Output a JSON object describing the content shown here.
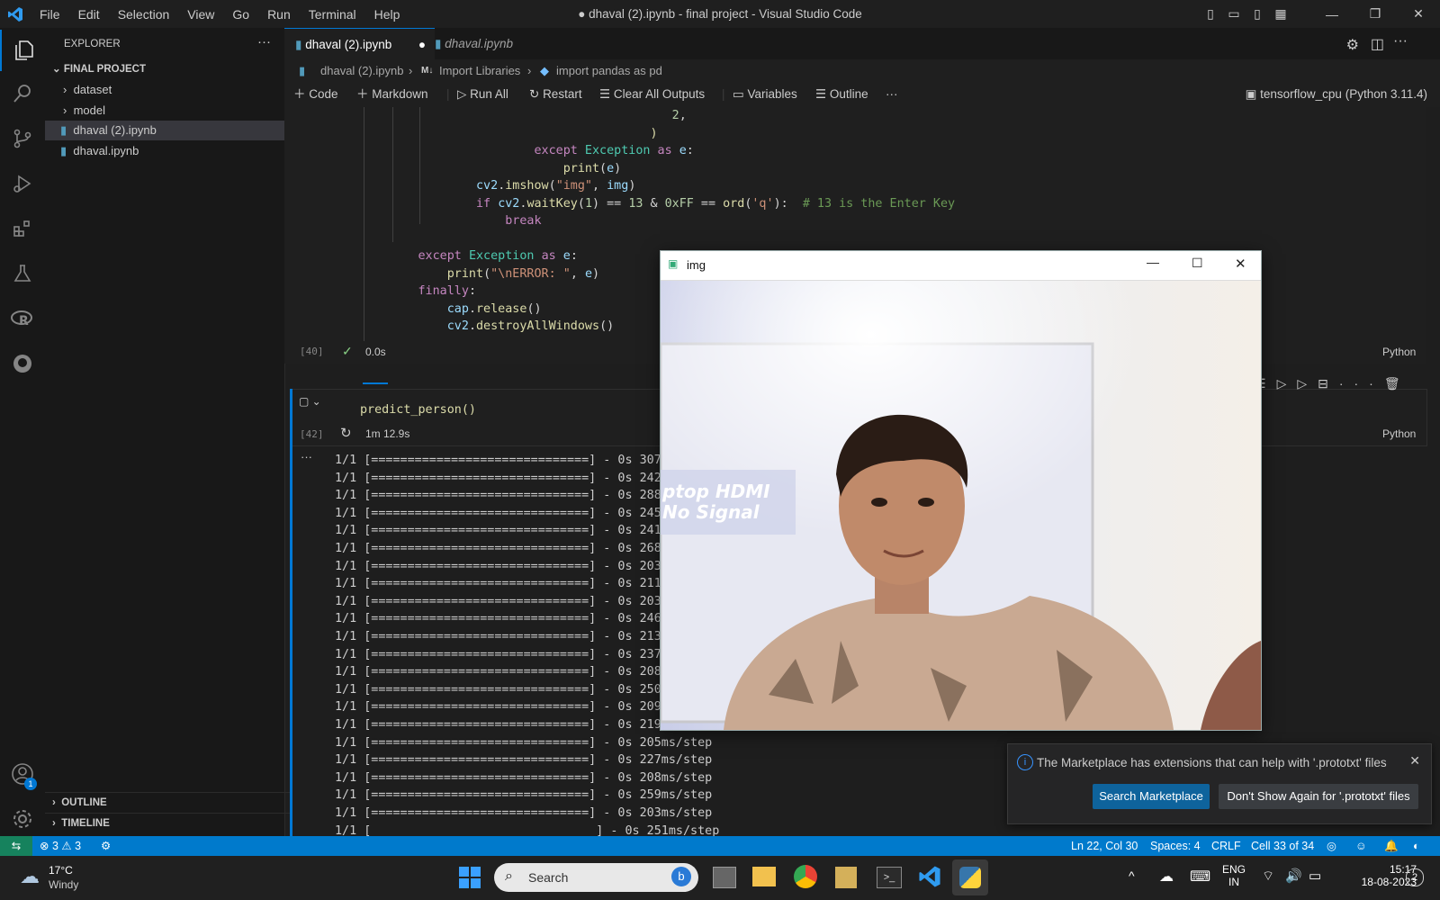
{
  "titlebar": {
    "menus": [
      "File",
      "Edit",
      "Selection",
      "View",
      "Go",
      "Run",
      "Terminal",
      "Help"
    ],
    "title": "● dhaval (2).ipynb - final project - Visual Studio Code"
  },
  "sidebar": {
    "header": "EXPLORER",
    "section": "FINAL PROJECT",
    "items": [
      {
        "label": "dataset",
        "type": "folder"
      },
      {
        "label": "model",
        "type": "folder"
      },
      {
        "label": "dhaval (2).ipynb",
        "type": "file",
        "selected": true
      },
      {
        "label": "dhaval.ipynb",
        "type": "file"
      }
    ],
    "outline": "OUTLINE",
    "timeline": "TIMELINE",
    "accounts_badge": "1"
  },
  "tabs": [
    {
      "label": "dhaval (2).ipynb",
      "active": true,
      "modified": true
    },
    {
      "label": "dhaval.ipynb",
      "active": false,
      "italic": true
    }
  ],
  "breadcrumb": {
    "file": "dhaval (2).ipynb",
    "section_prefix": "M↓",
    "section": "Import Libraries",
    "symbol": "import pandas as pd"
  },
  "toolbar": {
    "code": "Code",
    "markdown": "Markdown",
    "run_all": "Run All",
    "restart": "Restart",
    "clear": "Clear All Outputs",
    "variables": "Variables",
    "outline": "Outline",
    "kernel": "tensorflow_cpu (Python 3.11.4)"
  },
  "cell1": {
    "exec_count": "[40]",
    "time": "0.0s",
    "lang": "Python"
  },
  "cell2": {
    "exec_count": "[42]",
    "time": "1m 12.9s",
    "lang": "Python",
    "code": "predict_person()"
  },
  "output_lines": [
    {
      "prefix": "1/1 [==============================] - 0s ",
      "ms": "307"
    },
    {
      "prefix": "1/1 [==============================] - 0s ",
      "ms": "242"
    },
    {
      "prefix": "1/1 [==============================] - 0s ",
      "ms": "288"
    },
    {
      "prefix": "1/1 [==============================] - 0s ",
      "ms": "245"
    },
    {
      "prefix": "1/1 [==============================] - 0s ",
      "ms": "241"
    },
    {
      "prefix": "1/1 [==============================] - 0s ",
      "ms": "268"
    },
    {
      "prefix": "1/1 [==============================] - 0s ",
      "ms": "203"
    },
    {
      "prefix": "1/1 [==============================] - 0s ",
      "ms": "211"
    },
    {
      "prefix": "1/1 [==============================] - 0s ",
      "ms": "203"
    },
    {
      "prefix": "1/1 [==============================] - 0s ",
      "ms": "246"
    },
    {
      "prefix": "1/1 [==============================] - 0s ",
      "ms": "213"
    },
    {
      "prefix": "1/1 [==============================] - 0s ",
      "ms": "237"
    },
    {
      "prefix": "1/1 [==============================] - 0s ",
      "ms": "208"
    },
    {
      "prefix": "1/1 [==============================] - 0s ",
      "ms": "250"
    },
    {
      "prefix": "1/1 [==============================] - 0s ",
      "ms": "209"
    },
    {
      "prefix": "1/1 [==============================] - 0s ",
      "ms": "219ms/step"
    },
    {
      "prefix": "1/1 [==============================] - 0s ",
      "ms": "205ms/step"
    },
    {
      "prefix": "1/1 [==============================] - 0s ",
      "ms": "227ms/step"
    },
    {
      "prefix": "1/1 [==============================] - 0s ",
      "ms": "208ms/step"
    },
    {
      "prefix": "1/1 [==============================] - 0s ",
      "ms": "259ms/step"
    },
    {
      "prefix": "1/1 [==============================] - 0s ",
      "ms": "203ms/step"
    },
    {
      "prefix": "1/1 [",
      "ms": "                               ] - 0s 251ms/step"
    }
  ],
  "imgwin": {
    "title": "img",
    "overlay_line1": "ptop HDMI",
    "overlay_line2": "No Signal"
  },
  "notification": {
    "message": "The Marketplace has extensions that can help with '.prototxt' files",
    "primary": "Search Marketplace",
    "secondary": "Don't Show Again for '.prototxt' files"
  },
  "statusbar": {
    "errors": "3",
    "warnings": "3",
    "position": "Ln 22, Col 30",
    "spaces": "Spaces: 4",
    "eol": "CRLF",
    "cell": "Cell 33 of 34"
  },
  "taskbar": {
    "temp": "17°C",
    "weather": "Windy",
    "search": "Search",
    "lang1": "ENG",
    "lang2": "IN",
    "time": "15:17",
    "date": "18-08-2023",
    "badge": "2"
  },
  "colors": {
    "accent": "#007acc",
    "bg": "#1e1e1e",
    "sidebar": "#181818"
  }
}
